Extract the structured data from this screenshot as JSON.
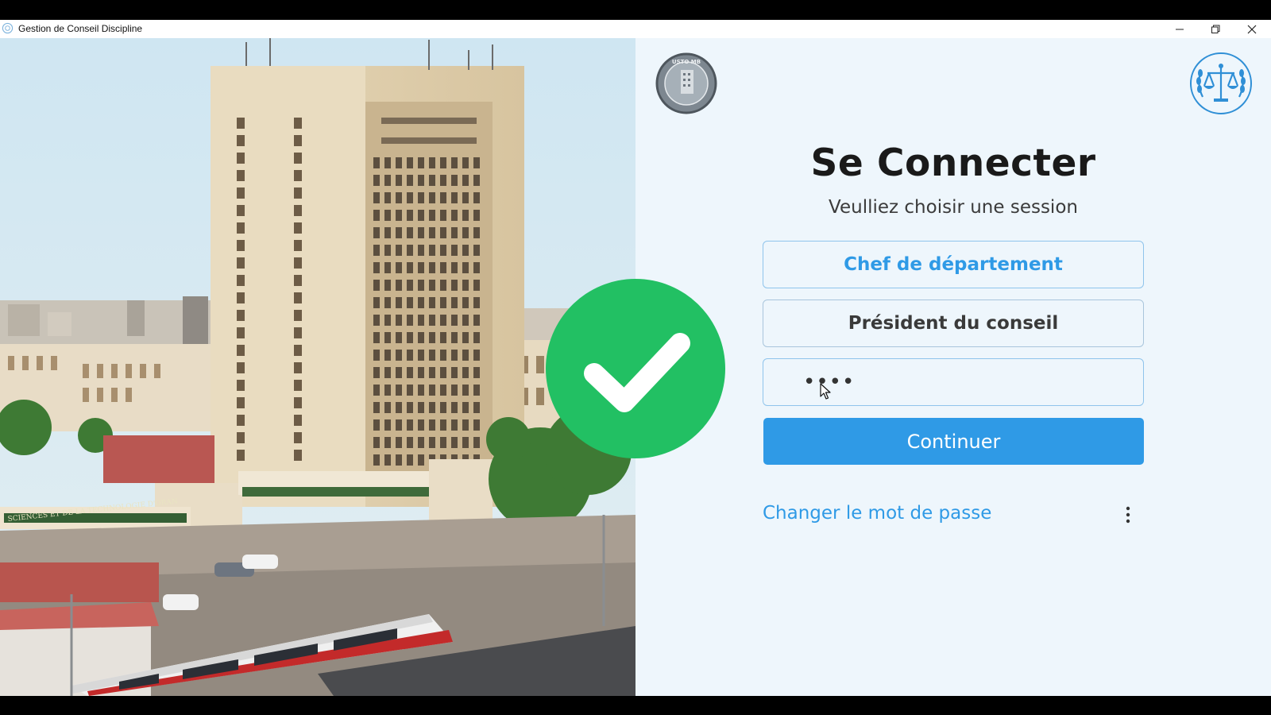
{
  "window": {
    "title": "Gestion de Conseil Discipline",
    "icon": "app-logo-icon",
    "controls": [
      "minimize-icon",
      "maximize-icon",
      "close-icon"
    ]
  },
  "photo": {
    "description_icon": "university-building-photo",
    "banner_text": "SCIENCES ET DE LA TECHNOLOGIE D'ORAN"
  },
  "logos": {
    "left_text": "USTO MB",
    "right": "scales-of-justice-icon"
  },
  "login": {
    "heading": "Se Connecter",
    "subheading": "Veulliez choisir une session",
    "session_options": [
      "Chef de département",
      "Président du conseil"
    ],
    "password_value": "••••",
    "continue_label": "Continuer",
    "change_password_label": "Changer le mot de passe"
  },
  "overlay": {
    "icon": "checkmark-icon",
    "color": "#22c063"
  },
  "colors": {
    "accent": "#2f9ae6",
    "panel_bg": "#eef6fc",
    "heading": "#1a1a1a"
  }
}
